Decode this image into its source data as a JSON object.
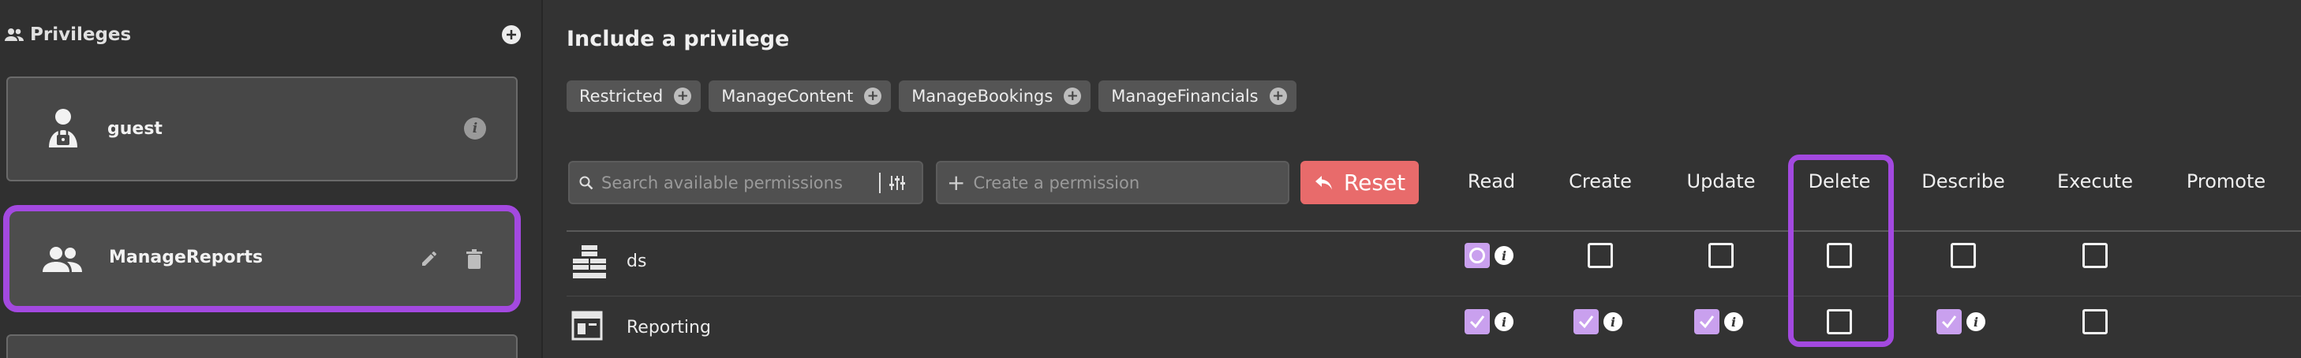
{
  "sidebar": {
    "title": "Privileges",
    "items": [
      {
        "name": "guest"
      },
      {
        "name": "ManageReports"
      }
    ]
  },
  "main": {
    "title": "Include a privilege",
    "chips": [
      "Restricted",
      "ManageContent",
      "ManageBookings",
      "ManageFinancials"
    ],
    "search_placeholder": "Search available permissions",
    "create_placeholder": "Create a permission",
    "reset_label": "Reset",
    "columns": [
      "Read",
      "Create",
      "Update",
      "Delete",
      "Describe",
      "Execute",
      "Promote"
    ],
    "rows": [
      {
        "name": "ds",
        "icon": "stacked-boxes-icon",
        "states": {
          "Read": "partial",
          "Create": "unchecked",
          "Update": "unchecked",
          "Delete": "unchecked",
          "Describe": "unchecked",
          "Execute": "unchecked"
        }
      },
      {
        "name": "Reporting",
        "icon": "report-window-icon",
        "states": {
          "Read": "checked",
          "Create": "checked",
          "Update": "checked",
          "Delete": "unchecked",
          "Describe": "checked",
          "Execute": "unchecked"
        }
      }
    ]
  },
  "colors": {
    "highlight": "#a349e0",
    "checkbox_on": "#c9a0ee",
    "reset": "#e86b6b"
  }
}
